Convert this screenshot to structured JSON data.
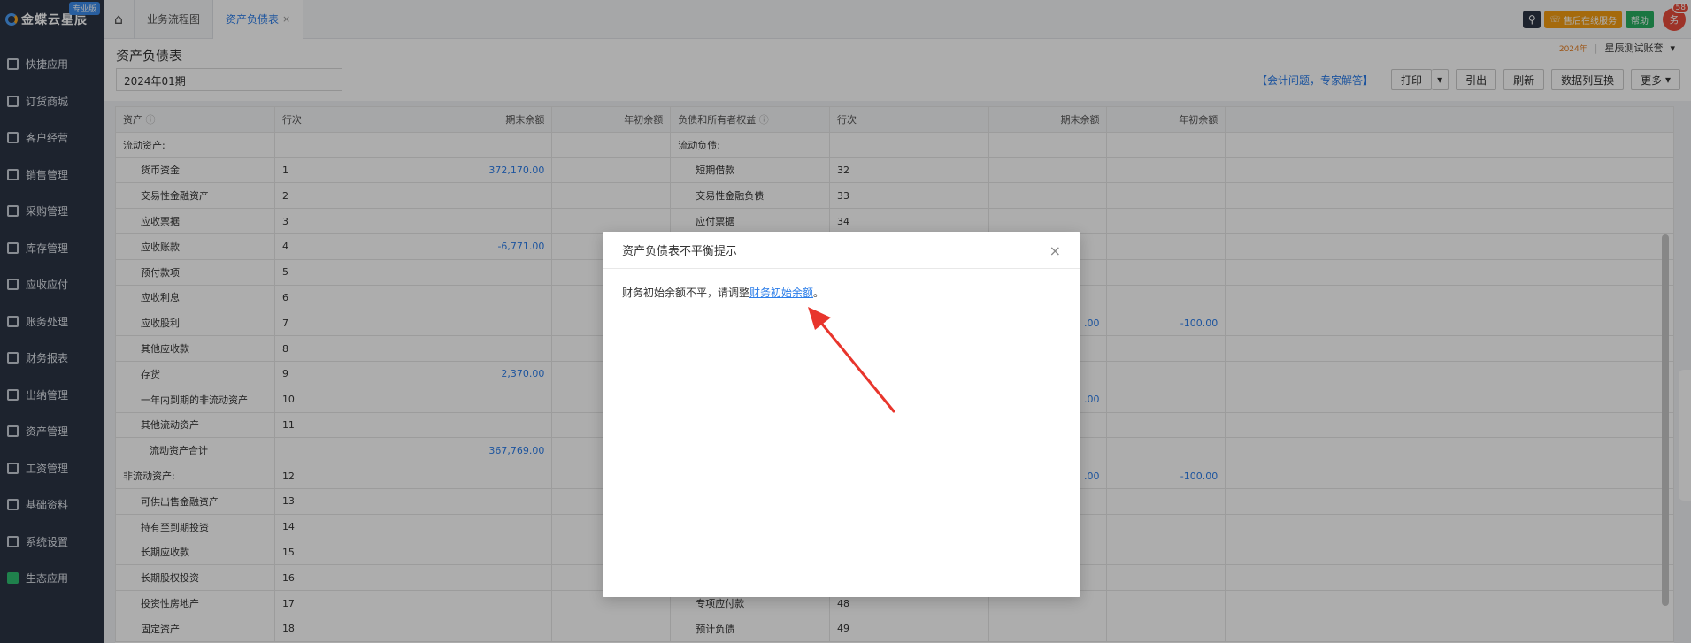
{
  "sidebar": {
    "brand": "金蝶云星辰",
    "edition": "专业版",
    "items": [
      {
        "label": "快捷应用",
        "icon": "grid-icon"
      },
      {
        "label": "订货商城",
        "icon": "shop-icon"
      },
      {
        "label": "客户经营",
        "icon": "user-icon"
      },
      {
        "label": "销售管理",
        "icon": "sales-icon"
      },
      {
        "label": "采购管理",
        "icon": "cart-icon"
      },
      {
        "label": "库存管理",
        "icon": "box-icon"
      },
      {
        "label": "应收应付",
        "icon": "money-icon"
      },
      {
        "label": "账务处理",
        "icon": "ledger-icon"
      },
      {
        "label": "财务报表",
        "icon": "report-icon"
      },
      {
        "label": "出纳管理",
        "icon": "cashier-icon"
      },
      {
        "label": "资产管理",
        "icon": "asset-icon"
      },
      {
        "label": "工资管理",
        "icon": "salary-icon"
      },
      {
        "label": "基础资料",
        "icon": "layers-icon"
      },
      {
        "label": "系统设置",
        "icon": "gear-icon"
      },
      {
        "label": "生态应用",
        "icon": "check-icon"
      }
    ]
  },
  "topbar": {
    "tabs": [
      {
        "label": "业务流程图"
      },
      {
        "label": "资产负债表",
        "close": "×"
      }
    ],
    "service_label": "售后在线服务",
    "help_label": "帮助",
    "avatar_text": "务",
    "notification_count": "58"
  },
  "page": {
    "title": "资产负债表",
    "period": "2024年01期",
    "year_badge": "2024年",
    "account_name": "星辰测试账套",
    "account_caret": "▾",
    "faq_link": "【会计问题，专家解答】",
    "buttons": {
      "print": "打印",
      "export": "引出",
      "refresh": "刷新",
      "swap": "数据列互换",
      "more": "更多"
    }
  },
  "table": {
    "headers": [
      "资产",
      "行次",
      "期末余额",
      "年初余额",
      "负债和所有者权益",
      "行次",
      "期末余额",
      "年初余额"
    ],
    "rows": [
      {
        "a": "流动资产:",
        "ai": 0,
        "an": "",
        "ae": "",
        "ab": "",
        "l": "流动负债:",
        "li": 0,
        "ln": "",
        "le": "",
        "lb": ""
      },
      {
        "a": "货币资金",
        "ai": 1,
        "an": "1",
        "ae": "372,170.00",
        "ab": "",
        "l": "短期借款",
        "li": 1,
        "ln": "32",
        "le": "",
        "lb": ""
      },
      {
        "a": "交易性金融资产",
        "ai": 1,
        "an": "2",
        "ae": "",
        "ab": "",
        "l": "交易性金融负债",
        "li": 1,
        "ln": "33",
        "le": "",
        "lb": ""
      },
      {
        "a": "应收票据",
        "ai": 1,
        "an": "3",
        "ae": "",
        "ab": "",
        "l": "应付票据",
        "li": 1,
        "ln": "34",
        "le": "",
        "lb": ""
      },
      {
        "a": "应收账款",
        "ai": 1,
        "an": "4",
        "ae": "-6,771.00",
        "ab": "",
        "l": "",
        "li": 1,
        "ln": "",
        "le": "",
        "lb": ""
      },
      {
        "a": "预付款项",
        "ai": 1,
        "an": "5",
        "ae": "",
        "ab": "",
        "l": "",
        "li": 1,
        "ln": "",
        "le": "",
        "lb": ""
      },
      {
        "a": "应收利息",
        "ai": 1,
        "an": "6",
        "ae": "",
        "ab": "",
        "l": "",
        "li": 1,
        "ln": "",
        "le": "",
        "lb": ""
      },
      {
        "a": "应收股利",
        "ai": 1,
        "an": "7",
        "ae": "",
        "ab": "",
        "l": "",
        "li": 1,
        "ln": "",
        "le": ".00",
        "lb": "-100.00"
      },
      {
        "a": "其他应收款",
        "ai": 1,
        "an": "8",
        "ae": "",
        "ab": "",
        "l": "",
        "li": 1,
        "ln": "",
        "le": "",
        "lb": ""
      },
      {
        "a": "存货",
        "ai": 1,
        "an": "9",
        "ae": "2,370.00",
        "ab": "",
        "l": "",
        "li": 1,
        "ln": "",
        "le": "",
        "lb": ""
      },
      {
        "a": "一年内到期的非流动资产",
        "ai": 1,
        "an": "10",
        "ae": "",
        "ab": "",
        "l": "",
        "li": 1,
        "ln": "",
        "le": ".00",
        "lb": ""
      },
      {
        "a": "其他流动资产",
        "ai": 1,
        "an": "11",
        "ae": "",
        "ab": "",
        "l": "",
        "li": 1,
        "ln": "",
        "le": "",
        "lb": ""
      },
      {
        "a": "流动资产合计",
        "ai": 2,
        "an": "",
        "ae": "367,769.00",
        "ab": "",
        "l": "",
        "li": 1,
        "ln": "",
        "le": "",
        "lb": ""
      },
      {
        "a": "非流动资产:",
        "ai": 0,
        "an": "12",
        "ae": "",
        "ab": "",
        "l": "",
        "li": 1,
        "ln": "",
        "le": ".00",
        "lb": "-100.00"
      },
      {
        "a": "可供出售金融资产",
        "ai": 1,
        "an": "13",
        "ae": "",
        "ab": "",
        "l": "",
        "li": 1,
        "ln": "",
        "le": "",
        "lb": ""
      },
      {
        "a": "持有至到期投资",
        "ai": 1,
        "an": "14",
        "ae": "",
        "ab": "",
        "l": "",
        "li": 1,
        "ln": "",
        "le": "",
        "lb": ""
      },
      {
        "a": "长期应收款",
        "ai": 1,
        "an": "15",
        "ae": "",
        "ab": "",
        "l": "",
        "li": 1,
        "ln": "",
        "le": "",
        "lb": ""
      },
      {
        "a": "长期股权投资",
        "ai": 1,
        "an": "16",
        "ae": "",
        "ab": "",
        "l": "",
        "li": 1,
        "ln": "",
        "le": "",
        "lb": ""
      },
      {
        "a": "投资性房地产",
        "ai": 1,
        "an": "17",
        "ae": "",
        "ab": "",
        "l": "专项应付款",
        "li": 1,
        "ln": "48",
        "le": "",
        "lb": ""
      },
      {
        "a": "固定资产",
        "ai": 1,
        "an": "18",
        "ae": "",
        "ab": "",
        "l": "预计负债",
        "li": 1,
        "ln": "49",
        "le": "",
        "lb": ""
      }
    ]
  },
  "modal": {
    "title": "资产负债表不平衡提示",
    "close": "×",
    "message": "财务初始余额不平，请调整",
    "link": "财务初始余额",
    "suffix": "。"
  },
  "colors": {
    "accent": "#2b7de9",
    "sidebar_bg": "#2b3445",
    "arrow": "#e8352c"
  }
}
